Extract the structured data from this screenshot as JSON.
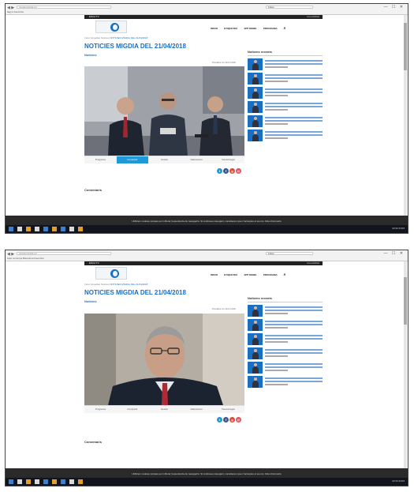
{
  "shots": [
    {
      "browser": {
        "url": "ravaterestatat.ag",
        "tab_label": "Fotos",
        "favorites": "ltag ls   Favoritos"
      },
      "site": {
        "brand": "ESCA TV",
        "lang": "Acessibilitat"
      },
      "nav": {
        "items": [
          "INICIO",
          "ETIQUETES",
          "APP MOBIL",
          "PROGRAMA"
        ]
      },
      "breadcrumb": {
        "trail": "Inicio Actualitat  Noticies",
        "current": "NOTICIES MIGDIA DEL 21/04/2018"
      },
      "article": {
        "title": "NOTICIES MIGDIA DEL 21/04/2018",
        "section": "Noticies",
        "date": "Dissabte 21 abril 2018"
      },
      "toolbar": {
        "buttons": [
          "Programa",
          "Compartir",
          "Gustar",
          "Valoracions",
          "Descarregar"
        ]
      },
      "shares": [
        {
          "icon": "twitter",
          "color": "#1e9ad8"
        },
        {
          "icon": "facebook",
          "color": "#3b5998"
        },
        {
          "icon": "google-plus",
          "color": "#dd4b39"
        },
        {
          "icon": "mail",
          "color": "#e0515a"
        }
      ],
      "comments": {
        "title": "Comentaris"
      },
      "sidebar": {
        "title": "Noticies recents"
      },
      "cookie": {
        "text": "Utilitzem cookies pròpies per millorar l'experiència de navegació. Si continues navegant, considerem que n'acceptes el seu ús. Més informació"
      },
      "taskbar": {
        "clock": "13:32  21/04"
      }
    },
    {
      "browser": {
        "url": "ravaterestatat.ag",
        "tab_label": "Fotos",
        "favorites": "Aquí comença Barcelona   Favoritos"
      },
      "site": {
        "brand": "ESCA TV",
        "lang": "Acessibilitat"
      },
      "nav": {
        "items": [
          "INICIO",
          "ETIQUETES",
          "APP MOBIL",
          "PROGRAMA"
        ]
      },
      "breadcrumb": {
        "trail": "Inicio Actualitat  Noticies",
        "current": "NOTICIES MIGDIA DEL 21/04/2018"
      },
      "article": {
        "title": "NOTICIES MIGDIA DEL 21/04/2018",
        "section": "Noticies",
        "date": "Dissabte 21 abril 2018"
      },
      "toolbar": {
        "buttons": [
          "Programa",
          "Compartir",
          "Gustar",
          "Valoracions",
          "Descarregar"
        ]
      },
      "shares": [
        {
          "icon": "twitter",
          "color": "#1e9ad8"
        },
        {
          "icon": "facebook",
          "color": "#3b5998"
        },
        {
          "icon": "google-plus",
          "color": "#dd4b39"
        },
        {
          "icon": "mail",
          "color": "#e0515a"
        }
      ],
      "comments": {
        "title": "Comentaris"
      },
      "sidebar": {
        "title": "Noticies recents"
      },
      "cookie": {
        "text": "Utilitzem cookies pròpies per millorar l'experiència de navegació. Si continues navegant, considerem que n'acceptes el seu ús. Més informació"
      },
      "taskbar": {
        "clock": "13:33  21/04"
      }
    }
  ],
  "colors": {
    "accent": "#1a6fc2",
    "toolbar_active": "#1e9ad8",
    "taskbar": "#11161e",
    "cookie_bar": "#2a2a2a"
  }
}
